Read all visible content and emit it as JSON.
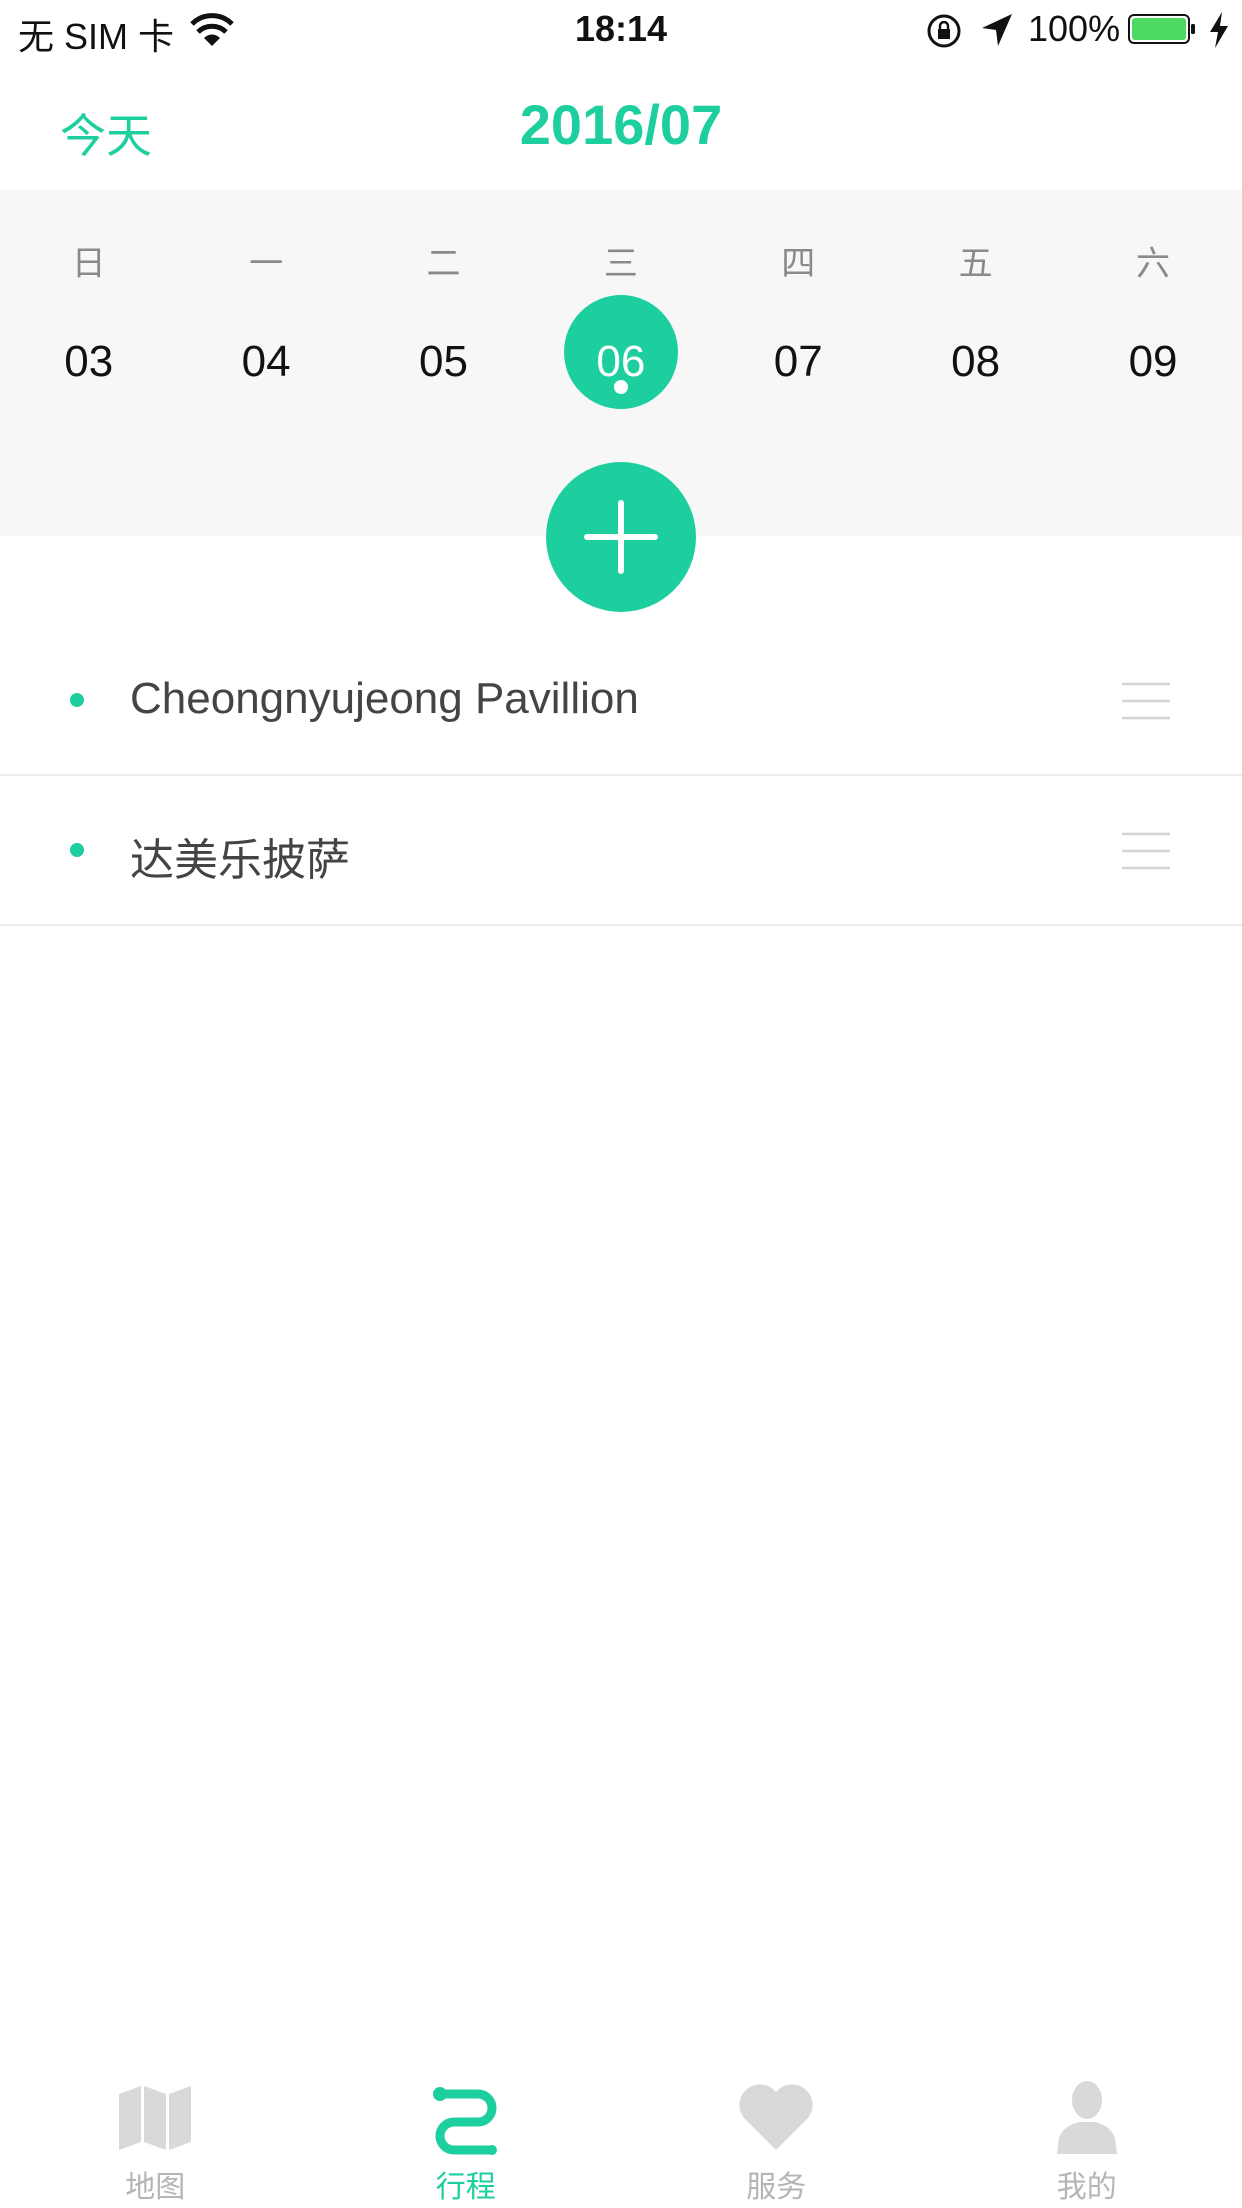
{
  "status_bar": {
    "carrier": "无 SIM 卡",
    "time": "18:14",
    "battery": "100%"
  },
  "header": {
    "today_label": "今天",
    "month": "2016/07"
  },
  "week": {
    "weekdays": [
      "日",
      "一",
      "二",
      "三",
      "四",
      "五",
      "六"
    ],
    "days": [
      "03",
      "04",
      "05",
      "06",
      "07",
      "08",
      "09"
    ],
    "selected_index": 3
  },
  "add_icon": "plus-icon",
  "items": [
    {
      "title": "Cheongnyujeong Pavillion"
    },
    {
      "title": "达美乐披萨"
    }
  ],
  "tabs": [
    {
      "label": "地图",
      "icon": "map-icon"
    },
    {
      "label": "行程",
      "icon": "route-icon",
      "active": true
    },
    {
      "label": "服务",
      "icon": "heart-icon"
    },
    {
      "label": "我的",
      "icon": "person-icon"
    }
  ],
  "colors": {
    "accent": "#1dcf9f",
    "inactive": "#d9d9d9",
    "panel": "#f7f7f7"
  }
}
